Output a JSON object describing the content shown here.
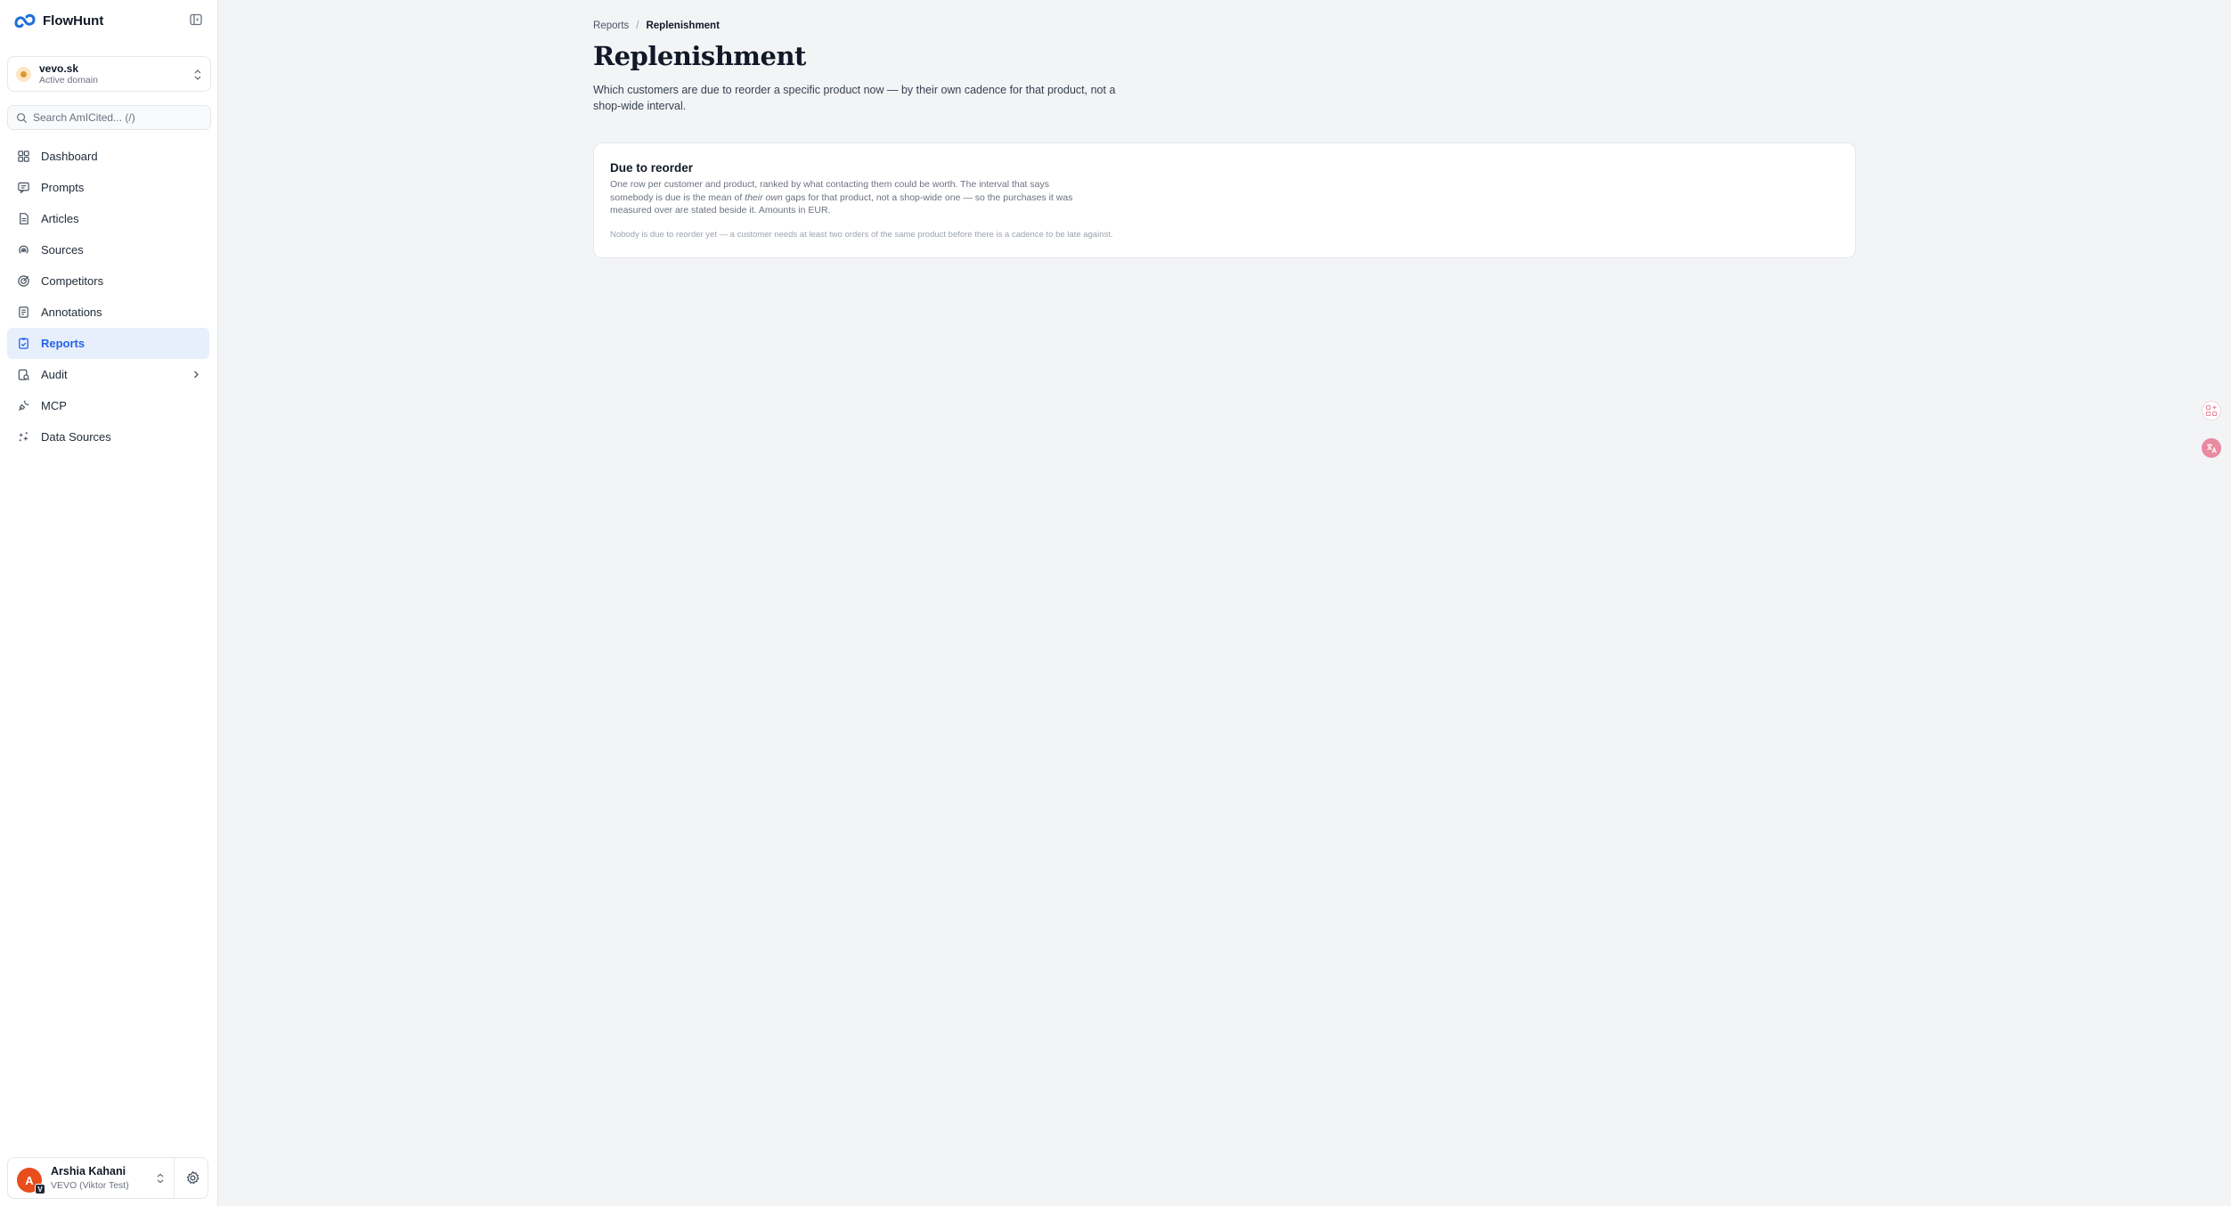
{
  "brand": {
    "name": "FlowHunt"
  },
  "domain": {
    "name": "vevo.sk",
    "subtitle": "Active domain"
  },
  "search": {
    "placeholder": "Search AmICited... (/)"
  },
  "nav": {
    "items": [
      {
        "label": "Dashboard",
        "icon": "dashboard-icon"
      },
      {
        "label": "Prompts",
        "icon": "prompts-icon"
      },
      {
        "label": "Articles",
        "icon": "articles-icon"
      },
      {
        "label": "Sources",
        "icon": "sources-icon"
      },
      {
        "label": "Competitors",
        "icon": "competitors-icon"
      },
      {
        "label": "Annotations",
        "icon": "annotations-icon"
      },
      {
        "label": "Reports",
        "icon": "reports-icon",
        "active": true
      },
      {
        "label": "Audit",
        "icon": "audit-icon"
      },
      {
        "label": "MCP",
        "icon": "mcp-icon"
      },
      {
        "label": "Data Sources",
        "icon": "data-sources-icon"
      }
    ]
  },
  "user": {
    "initial": "A",
    "badge": "V",
    "name": "Arshia Kahani",
    "org": "VEVO (Viktor Test)"
  },
  "breadcrumb": {
    "parent": "Reports",
    "separator": "/",
    "current": "Replenishment"
  },
  "page": {
    "title": "Replenishment",
    "description": "Which customers are due to reorder a specific product now — by their own cadence for that product, not a shop-wide interval."
  },
  "card": {
    "title": "Due to reorder",
    "desc_before": "One row per customer and product, ranked by what contacting them could be worth. The interval that says somebody is due is the mean of ",
    "desc_em": "their own",
    "desc_after": " gaps for that product, not a shop-wide one — so the purchases it was measured over are stated beside it. Amounts in EUR.",
    "empty": "Nobody is due to reorder yet — a customer needs at least two orders of the same product before there is a cadence to be late against."
  },
  "colors": {
    "accent": "#2563eb",
    "active_bg": "#e7effc",
    "avatar": "#e84d1c",
    "brand": "#1d6fd8"
  }
}
